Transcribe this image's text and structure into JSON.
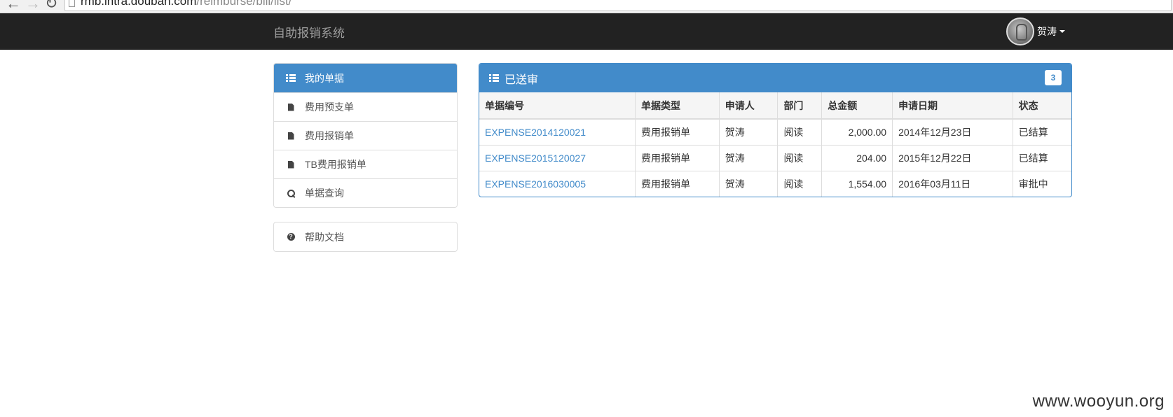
{
  "browser": {
    "url_host": "rmb.intra.douban.com",
    "url_path": "/reimburse/bill/list/"
  },
  "navbar": {
    "brand": "自助报销系统",
    "user_name": "贺涛"
  },
  "sidebar": {
    "items": [
      {
        "label": "我的单据",
        "icon": "list-icon",
        "active": true
      },
      {
        "label": "费用预支单",
        "icon": "file-icon"
      },
      {
        "label": "费用报销单",
        "icon": "file-icon"
      },
      {
        "label": "TB费用报销单",
        "icon": "file-icon"
      },
      {
        "label": "单据查询",
        "icon": "search-icon"
      }
    ],
    "help": {
      "label": "帮助文档",
      "icon": "question-circle-icon"
    }
  },
  "panel": {
    "title": "已送审",
    "badge": "3",
    "columns": [
      "单据编号",
      "单据类型",
      "申请人",
      "部门",
      "总金额",
      "申请日期",
      "状态"
    ],
    "rows": [
      [
        "EXPENSE2014120021",
        "费用报销单",
        "贺涛",
        "阅读",
        "2,000.00",
        "2014年12月23日",
        "已结算"
      ],
      [
        "EXPENSE2015120027",
        "费用报销单",
        "贺涛",
        "阅读",
        "204.00",
        "2015年12月22日",
        "已结算"
      ],
      [
        "EXPENSE2016030005",
        "费用报销单",
        "贺涛",
        "阅读",
        "1,554.00",
        "2016年03月11日",
        "审批中"
      ]
    ]
  },
  "watermark": "www.wooyun.org",
  "colors": {
    "primary": "#428bca",
    "navbar_bg": "#222222",
    "brand_text": "#9d9d9d"
  }
}
